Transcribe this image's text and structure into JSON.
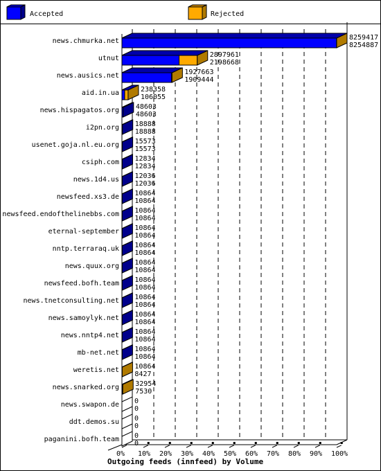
{
  "chart_data": {
    "type": "bar",
    "orientation": "horizontal",
    "style": "3d",
    "title": "Outgoing feeds (innfeed) by Volume",
    "xlabel": "",
    "ylabel": "",
    "x_tick_labels": [
      "0%",
      "10%",
      "20%",
      "30%",
      "40%",
      "50%",
      "60%",
      "70%",
      "80%",
      "90%",
      "100%"
    ],
    "xlim_percent": [
      0,
      100
    ],
    "grid": "vertical dashed",
    "legend_position": "top",
    "scale_max": 8259417,
    "categories": [
      "news.chmurka.net",
      "utnut",
      "news.ausics.net",
      "aid.in.ua",
      "news.hispagatos.org",
      "i2pn.org",
      "usenet.goja.nl.eu.org",
      "csiph.com",
      "news.1d4.us",
      "newsfeed.xs3.de",
      "newsfeed.endofthelinebbs.com",
      "eternal-september",
      "nntp.terraraq.uk",
      "news.quux.org",
      "newsfeed.bofh.team",
      "news.tnetconsulting.net",
      "news.samoylyk.net",
      "news.nntp4.net",
      "mb-net.net",
      "weretis.net",
      "news.snarked.org",
      "news.swapon.de",
      "ddt.demos.su",
      "paganini.bofh.team"
    ],
    "series": [
      {
        "name": "Accepted",
        "color": "#0000ff",
        "values": [
          8254887,
          2198668,
          1909444,
          106055,
          48603,
          18888,
          15573,
          12834,
          12036,
          10864,
          10864,
          10864,
          10864,
          10864,
          10864,
          10864,
          10864,
          10864,
          10864,
          8427,
          7530,
          0,
          0,
          0
        ]
      },
      {
        "name": "Rejected",
        "color": "#ffaa00",
        "values": [
          4530,
          699293,
          18219,
          132303,
          0,
          0,
          0,
          0,
          0,
          0,
          0,
          0,
          0,
          0,
          0,
          0,
          0,
          0,
          0,
          2437,
          25424,
          0,
          0,
          0
        ]
      }
    ],
    "totals": [
      8259417,
      2897961,
      1927663,
      238358,
      48603,
      18888,
      15573,
      12834,
      12036,
      10864,
      10864,
      10864,
      10864,
      10864,
      10864,
      10864,
      10864,
      10864,
      10864,
      10864,
      32954,
      0,
      0,
      0
    ],
    "accepted_labels": [
      8254887,
      2198668,
      1909444,
      106055,
      48603,
      18888,
      15573,
      12834,
      12036,
      10864,
      10864,
      10864,
      10864,
      10864,
      10864,
      10864,
      10864,
      10864,
      10864,
      8427,
      7530,
      0,
      0,
      0
    ]
  },
  "legend": [
    {
      "label": "Accepted",
      "color": "#0000ff"
    },
    {
      "label": "Rejected",
      "color": "#ffaa00"
    }
  ]
}
